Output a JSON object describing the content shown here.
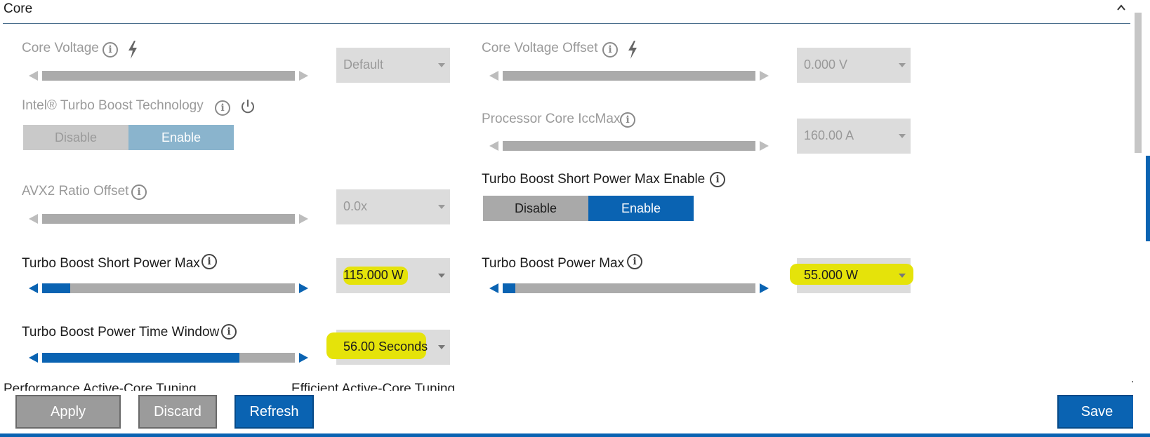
{
  "section": {
    "title": "Core"
  },
  "left": {
    "core_voltage": {
      "label": "Core Voltage",
      "value": "Default",
      "level": 1.0
    },
    "turbo_boost_tech": {
      "label": "Intel® Turbo Boost Technology",
      "disable": "Disable",
      "enable": "Enable",
      "selected": "Enable"
    },
    "avx2": {
      "label": "AVX2 Ratio Offset",
      "value": "0.0x",
      "level": 1.0
    },
    "short_power_max": {
      "label": "Turbo Boost Short Power Max",
      "value": "115.000 W",
      "level": 0.11
    },
    "power_time_window": {
      "label": "Turbo Boost Power Time Window",
      "value": "56.00 Seconds",
      "level": 0.78
    }
  },
  "right": {
    "core_voltage_offset": {
      "label": "Core Voltage Offset",
      "value": "0.000 V",
      "level": 1.0
    },
    "iccmax": {
      "label": "Processor Core IccMax",
      "value": "160.00 A",
      "level": 1.0
    },
    "short_power_max_enable": {
      "label": "Turbo Boost Short Power Max Enable",
      "disable": "Disable",
      "enable": "Enable",
      "selected": "Enable"
    },
    "power_max": {
      "label": "Turbo Boost Power Max",
      "value": "55.000 W",
      "level": 0.05
    }
  },
  "subsections": {
    "performance": "Performance Active-Core Tuning",
    "efficient": "Efficient Active-Core Tuning"
  },
  "footer": {
    "apply": "Apply",
    "discard": "Discard",
    "refresh": "Refresh",
    "save": "Save"
  },
  "colors": {
    "accent": "#0a63b2",
    "disabled_track": "#ababab",
    "highlight": "#e5e30a",
    "dropdown_bg": "#dcdcdc"
  }
}
